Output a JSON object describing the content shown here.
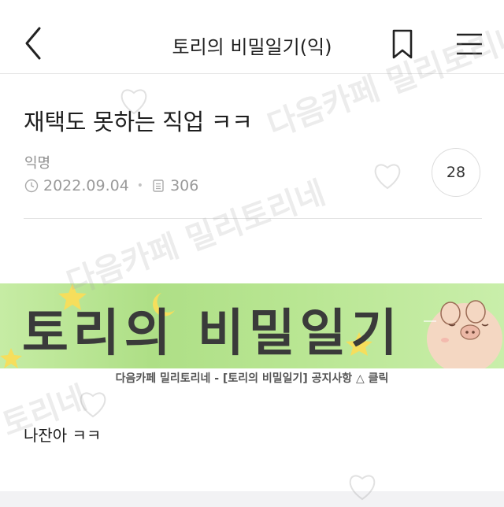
{
  "header": {
    "title": "토리의 비밀일기(익)"
  },
  "post": {
    "title": "재택도 못하는 직업 ㅋㅋ",
    "author": "익명",
    "date": "2022.09.04",
    "views": "306",
    "comment_count": "28"
  },
  "banner": {
    "text": "토리의 비밀일기",
    "caption": "다음카페 밀리토리네 - [토리의 비밀일기] 공지사항 △ 클릭"
  },
  "content": {
    "body": "나잔아 ㅋㅋ"
  },
  "watermarks": {
    "text1": "다음카페 밀리토리네",
    "text2": "토리네",
    "text3": "다음카페 밀리토리네"
  }
}
